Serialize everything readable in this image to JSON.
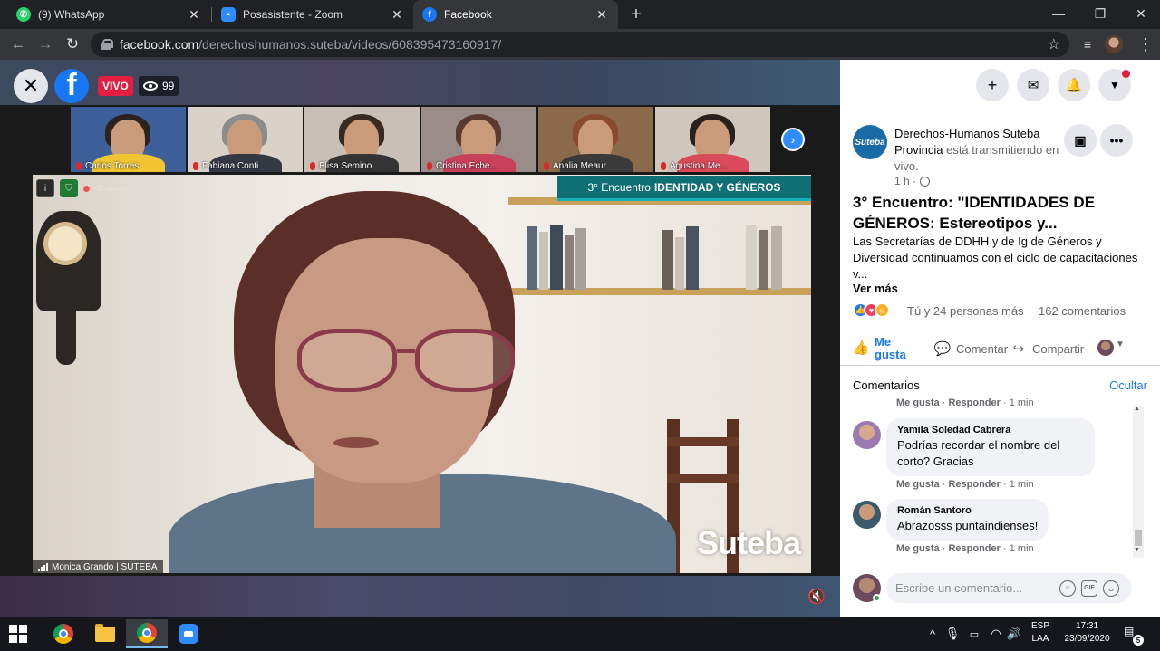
{
  "browser": {
    "tabs": [
      {
        "title": "(9) WhatsApp",
        "icon": "whatsapp-icon",
        "color": "#25d366"
      },
      {
        "title": "Posasistente - Zoom",
        "icon": "zoom-icon",
        "color": "#2d8cff"
      },
      {
        "title": "Facebook",
        "icon": "facebook-icon",
        "color": "#1877f2"
      }
    ],
    "url_host": "facebook.com",
    "url_path": "/derechoshumanos.suteba/videos/608395473160917/"
  },
  "video": {
    "live_label": "VIVO",
    "viewers": "99",
    "participants": [
      {
        "name": "Carlos Torres",
        "bg": "#3d5f9a",
        "hair": "#2c2220",
        "body": "#f0c531"
      },
      {
        "name": "Fabiana Conti",
        "bg": "#d9d2c8",
        "hair": "#8c8c8c",
        "body": "#333844"
      },
      {
        "name": "Elisa Semino",
        "bg": "#c8c0b6",
        "hair": "#3a2a24",
        "body": "#333333"
      },
      {
        "name": "Cristina Eche...",
        "bg": "#9a8c88",
        "hair": "#5a3a30",
        "body": "#c8405a"
      },
      {
        "name": "Analia Meaur",
        "bg": "#8a6a4a",
        "hair": "#8a4a30",
        "body": "#3a3a3a"
      },
      {
        "name": "Agustina Me...",
        "bg": "#cfc6bc",
        "hair": "#2a201c",
        "body": "#d94a5a"
      }
    ],
    "banner_prefix": "3° Encuentro",
    "banner_bold": "IDENTIDAD Y GÉNEROS",
    "recording_label": "Grabación",
    "speaker_name": "Monica Grando | SUTEBA",
    "watermark": "Suteba"
  },
  "post": {
    "page_avatar_text": "Suteba",
    "page_name": "Derechos-Humanos Suteba Provincia",
    "status": "está transmitiendo en vivo.",
    "time": "1 h ·",
    "title": "3° Encuentro: \"IDENTIDADES DE GÉNEROS: Estereotipos y...",
    "description": "Las Secretarías de DDHH y de Ig de Géneros y Diversidad continuamos con el ciclo de capacitaciones v...",
    "see_more": "Ver más",
    "reactions_text": "Tú y 24 personas más",
    "comments_count": "162 comentarios",
    "actions": {
      "like": "Me gusta",
      "comment": "Comentar",
      "share": "Compartir"
    }
  },
  "comments": {
    "header": "Comentarios",
    "hide": "Ocultar",
    "top_meta": {
      "like": "Me gusta",
      "reply": "Responder",
      "time": "1 min"
    },
    "items": [
      {
        "author": "Yamila Soledad Cabrera",
        "text": "Podrías recordar el nombre del corto? Gracias",
        "like": "Me gusta",
        "reply": "Responder",
        "time": "1 min"
      },
      {
        "author": "Román Santoro",
        "text": "Abrazosss puntaindienses!",
        "like": "Me gusta",
        "reply": "Responder",
        "time": "1 min"
      }
    ],
    "composer_placeholder": "Escribe un comentario..."
  },
  "taskbar": {
    "lang_line1": "ESP",
    "lang_line2": "LAA",
    "time": "17:31",
    "date": "23/09/2020",
    "notification_count": "5"
  }
}
